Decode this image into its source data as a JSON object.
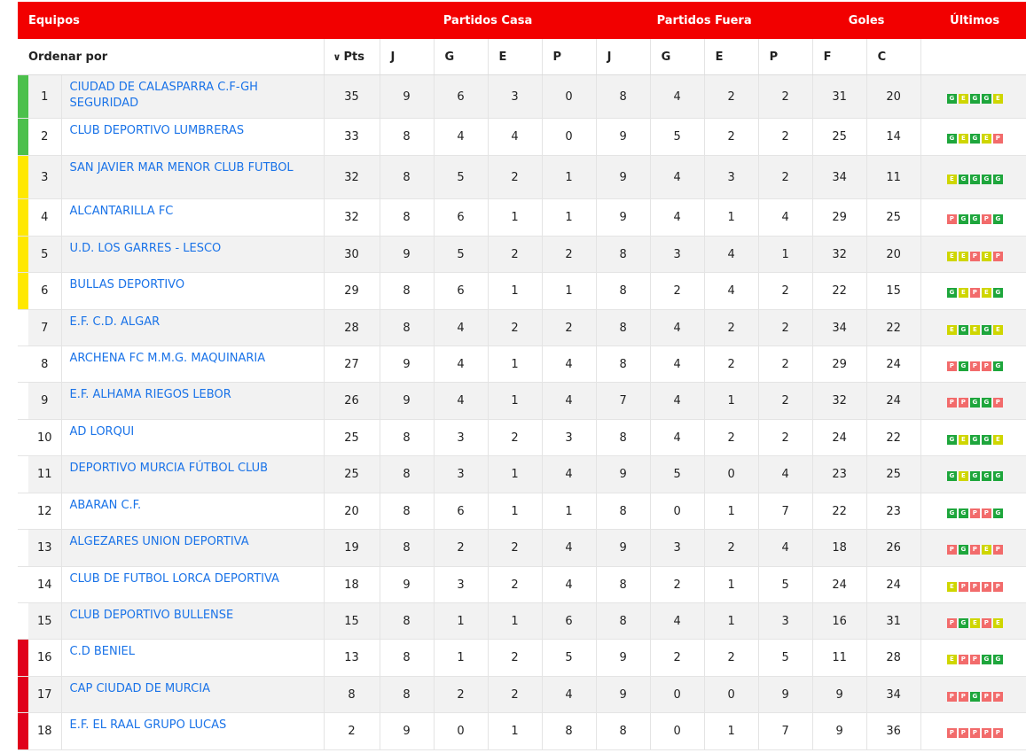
{
  "header": {
    "teams": "Equipos",
    "home": "Partidos Casa",
    "away": "Partidos Fuera",
    "goals": "Goles",
    "last": "Últimos"
  },
  "subheader": {
    "order_by": "Ordenar por",
    "pts": "Pts",
    "home_j": "J",
    "home_g": "G",
    "home_e": "E",
    "home_p": "P",
    "away_j": "J",
    "away_g": "G",
    "away_e": "E",
    "away_p": "P",
    "goals_f": "F",
    "goals_c": "C"
  },
  "colors": {
    "header_bg": "#f20000",
    "zone_green": "#4cc04c",
    "zone_yellow": "#ffe800",
    "zone_red": "#e0001b",
    "link": "#1a73e8",
    "badge_G": "#1ea63c",
    "badge_E": "#cfd600",
    "badge_P": "#f26b6b"
  },
  "rows": [
    {
      "pos": "1",
      "team": "CIUDAD DE CALASPARRA C.F-GH SEGURIDAD",
      "pts": "35",
      "hj": "9",
      "hg": "6",
      "he": "3",
      "hp": "0",
      "aj": "8",
      "ag": "4",
      "ae": "2",
      "ap": "2",
      "f": "31",
      "c": "20",
      "last": "GEGGE",
      "zone": "green",
      "h": 49
    },
    {
      "pos": "2",
      "team": "CLUB DEPORTIVO LUMBRERAS",
      "pts": "33",
      "hj": "8",
      "hg": "4",
      "he": "4",
      "hp": "0",
      "aj": "9",
      "ag": "5",
      "ae": "2",
      "ap": "2",
      "f": "25",
      "c": "14",
      "last": "GEGEP",
      "zone": "green",
      "h": 42
    },
    {
      "pos": "3",
      "team": "SAN JAVIER MAR MENOR CLUB FUTBOL",
      "pts": "32",
      "hj": "8",
      "hg": "5",
      "he": "2",
      "hp": "1",
      "aj": "9",
      "ag": "4",
      "ae": "3",
      "ap": "2",
      "f": "34",
      "c": "11",
      "last": "EGGGG",
      "zone": "yellow",
      "h": 49
    },
    {
      "pos": "4",
      "team": "ALCANTARILLA FC",
      "pts": "32",
      "hj": "8",
      "hg": "6",
      "he": "1",
      "hp": "1",
      "aj": "9",
      "ag": "4",
      "ae": "1",
      "ap": "4",
      "f": "29",
      "c": "25",
      "last": "PGGPG",
      "zone": "yellow",
      "h": 42
    },
    {
      "pos": "5",
      "team": "U.D. LOS GARRES - LESCO",
      "pts": "30",
      "hj": "9",
      "hg": "5",
      "he": "2",
      "hp": "2",
      "aj": "8",
      "ag": "3",
      "ae": "4",
      "ap": "1",
      "f": "32",
      "c": "20",
      "last": "EEPEP",
      "zone": "yellow",
      "h": 41
    },
    {
      "pos": "6",
      "team": "BULLAS DEPORTIVO",
      "pts": "29",
      "hj": "8",
      "hg": "6",
      "he": "1",
      "hp": "1",
      "aj": "8",
      "ag": "2",
      "ae": "4",
      "ap": "2",
      "f": "22",
      "c": "15",
      "last": "GEPEG",
      "zone": "yellow",
      "h": 42
    },
    {
      "pos": "7",
      "team": "E.F. C.D. ALGAR",
      "pts": "28",
      "hj": "8",
      "hg": "4",
      "he": "2",
      "hp": "2",
      "aj": "8",
      "ag": "4",
      "ae": "2",
      "ap": "2",
      "f": "34",
      "c": "22",
      "last": "EGEGE",
      "zone": "none",
      "h": 41
    },
    {
      "pos": "8",
      "team": "ARCHENA FC M.M.G. MAQUINARIA",
      "pts": "27",
      "hj": "9",
      "hg": "4",
      "he": "1",
      "hp": "4",
      "aj": "8",
      "ag": "4",
      "ae": "2",
      "ap": "2",
      "f": "29",
      "c": "24",
      "last": "PGPPG",
      "zone": "none",
      "h": 41
    },
    {
      "pos": "9",
      "team": "E.F. ALHAMA RIEGOS LEBOR",
      "pts": "26",
      "hj": "9",
      "hg": "4",
      "he": "1",
      "hp": "4",
      "aj": "7",
      "ag": "4",
      "ae": "1",
      "ap": "2",
      "f": "32",
      "c": "24",
      "last": "PPGGP",
      "zone": "none",
      "h": 42
    },
    {
      "pos": "10",
      "team": "AD LORQUI",
      "pts": "25",
      "hj": "8",
      "hg": "3",
      "he": "2",
      "hp": "3",
      "aj": "8",
      "ag": "4",
      "ae": "2",
      "ap": "2",
      "f": "24",
      "c": "22",
      "last": "GEGGE",
      "zone": "none",
      "h": 41
    },
    {
      "pos": "11",
      "team": "DEPORTIVO MURCIA FÚTBOL CLUB",
      "pts": "25",
      "hj": "8",
      "hg": "3",
      "he": "1",
      "hp": "4",
      "aj": "9",
      "ag": "5",
      "ae": "0",
      "ap": "4",
      "f": "23",
      "c": "25",
      "last": "GEGGG",
      "zone": "none",
      "h": 42
    },
    {
      "pos": "12",
      "team": "ABARAN C.F.",
      "pts": "20",
      "hj": "8",
      "hg": "6",
      "he": "1",
      "hp": "1",
      "aj": "8",
      "ag": "0",
      "ae": "1",
      "ap": "7",
      "f": "22",
      "c": "23",
      "last": "GGPPG",
      "zone": "none",
      "h": 41
    },
    {
      "pos": "13",
      "team": "ALGEZARES UNION DEPORTIVA",
      "pts": "19",
      "hj": "8",
      "hg": "2",
      "he": "2",
      "hp": "4",
      "aj": "9",
      "ag": "3",
      "ae": "2",
      "ap": "4",
      "f": "18",
      "c": "26",
      "last": "PGPEP",
      "zone": "none",
      "h": 42
    },
    {
      "pos": "14",
      "team": "CLUB DE FUTBOL LORCA DEPORTIVA",
      "pts": "18",
      "hj": "9",
      "hg": "3",
      "he": "2",
      "hp": "4",
      "aj": "8",
      "ag": "2",
      "ae": "1",
      "ap": "5",
      "f": "24",
      "c": "24",
      "last": "EPPPP",
      "zone": "none",
      "h": 41
    },
    {
      "pos": "15",
      "team": "CLUB DEPORTIVO BULLENSE",
      "pts": "15",
      "hj": "8",
      "hg": "1",
      "he": "1",
      "hp": "6",
      "aj": "8",
      "ag": "4",
      "ae": "1",
      "ap": "3",
      "f": "16",
      "c": "31",
      "last": "PGEPE",
      "zone": "none",
      "h": 41
    },
    {
      "pos": "16",
      "team": "C.D BENIEL",
      "pts": "13",
      "hj": "8",
      "hg": "1",
      "he": "2",
      "hp": "5",
      "aj": "9",
      "ag": "2",
      "ae": "2",
      "ap": "5",
      "f": "11",
      "c": "28",
      "last": "EPPGG",
      "zone": "red",
      "h": 42
    },
    {
      "pos": "17",
      "team": "CAP CIUDAD DE MURCIA",
      "pts": "8",
      "hj": "8",
      "hg": "2",
      "he": "2",
      "hp": "4",
      "aj": "9",
      "ag": "0",
      "ae": "0",
      "ap": "9",
      "f": "9",
      "c": "34",
      "last": "PPGPP",
      "zone": "red",
      "h": 41
    },
    {
      "pos": "18",
      "team": "E.F. EL RAAL GRUPO LUCAS",
      "pts": "2",
      "hj": "9",
      "hg": "0",
      "he": "1",
      "hp": "8",
      "aj": "8",
      "ag": "0",
      "ae": "1",
      "ap": "7",
      "f": "9",
      "c": "36",
      "last": "PPPPP",
      "zone": "red",
      "h": 42
    }
  ]
}
